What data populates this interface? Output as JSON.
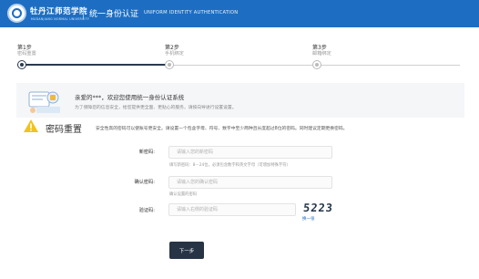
{
  "header": {
    "school_name": "牡丹江师范学院",
    "school_name_en": "MUDANJIANG NORMAL UNIVERSITY",
    "system_title": "统一身份认证",
    "system_title_en": "UNIFORM IDENTITY AUTHENTICATION",
    "bg_color": "#1d6ec2"
  },
  "steps": [
    {
      "label": "第1步",
      "sub": "密码重置",
      "state": "active"
    },
    {
      "label": "第2步",
      "sub": "手机绑定",
      "state": "pending"
    },
    {
      "label": "第3步",
      "sub": "邮箱绑定",
      "state": "pending"
    }
  ],
  "welcome": {
    "title": "亲爱的***，欢迎您使用统一身份认证系统",
    "desc": "为了保障您的信息安全，给您提供更全面、更贴心的服务，请按向导进行设置设置。"
  },
  "section": {
    "title": "密码重置",
    "desc": "安全性高的密码可以使账号更安全。请设置一个包含字母、符号、数字中至少两种且长度超过8位的密码。同时建议定期更换密码。"
  },
  "form": {
    "new_password": {
      "label": "新密码:",
      "placeholder": "请输入您的新密码",
      "hint": "填写新密码：8－24位，必须包含数字和英文字母（可增加特殊字符）"
    },
    "confirm_password": {
      "label": "确认密码:",
      "placeholder": "请输入您的确认密码",
      "hint": "确认设置的密码"
    },
    "captcha": {
      "label": "验证码:",
      "placeholder": "请输入右侧的验证码",
      "image_text": "5223",
      "refresh_label": "换一张"
    }
  },
  "actions": {
    "next_label": "下一步",
    "next_color": "#263445"
  }
}
